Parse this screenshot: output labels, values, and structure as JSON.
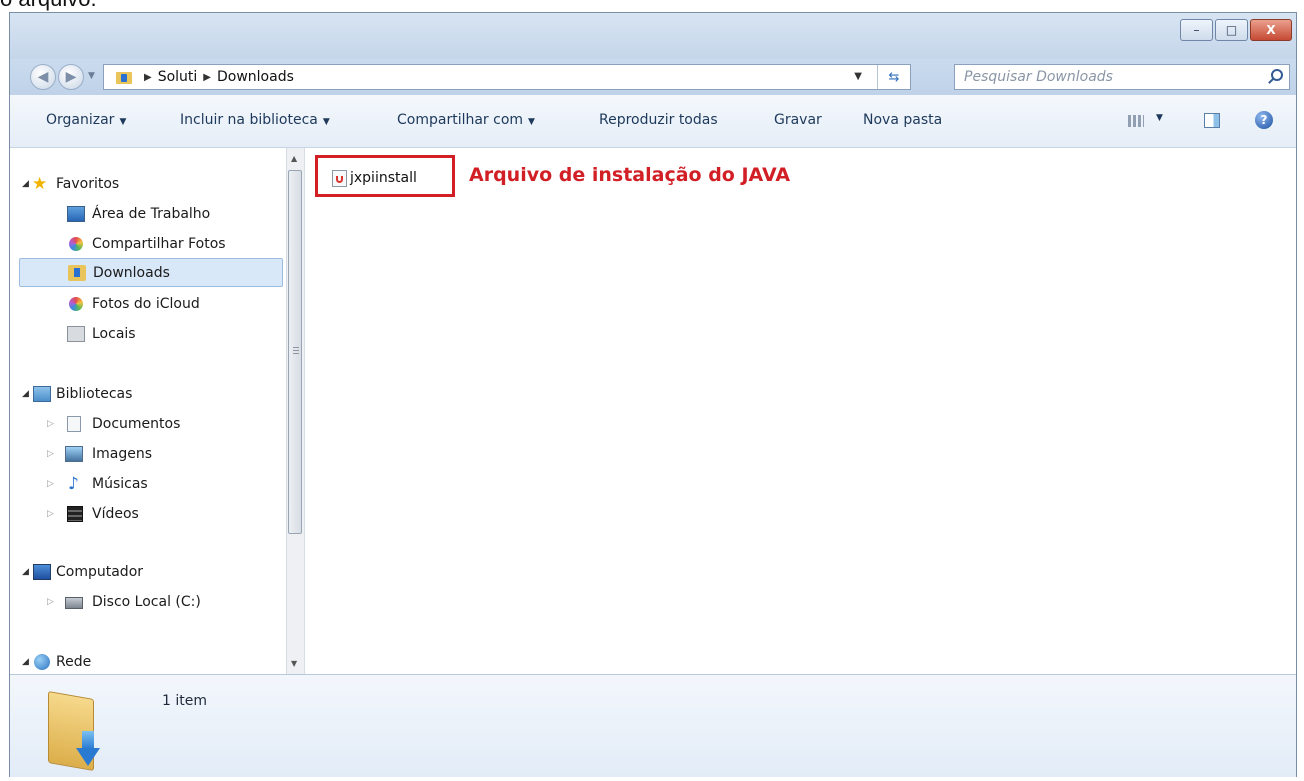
{
  "caption_above": "o arquivo.",
  "window": {
    "caption_buttons": {
      "minimize": "–",
      "maximize": "□",
      "close": "X"
    }
  },
  "address": {
    "crumbs": [
      "Soluti",
      "Downloads"
    ],
    "search_placeholder": "Pesquisar Downloads"
  },
  "toolbar": {
    "organize": "Organizar",
    "include_library": "Incluir na biblioteca",
    "share_with": "Compartilhar com",
    "play_all": "Reproduzir todas",
    "burn": "Gravar",
    "new_folder": "Nova pasta"
  },
  "nav": {
    "favorites": "Favoritos",
    "desktop": "Área de Trabalho",
    "shared_photos": "Compartilhar Fotos",
    "downloads": "Downloads",
    "icloud_photos": "Fotos do iCloud",
    "places": "Locais",
    "libraries": "Bibliotecas",
    "documents": "Documentos",
    "pictures": "Imagens",
    "music": "Músicas",
    "videos": "Vídeos",
    "computer": "Computador",
    "local_disk": "Disco Local (C:)",
    "network": "Rede"
  },
  "content": {
    "file_name": "jxpiinstall",
    "annotation": "Arquivo de instalação do JAVA"
  },
  "details": {
    "item_count": "1 item"
  },
  "colors": {
    "annotation_red": "#d11f25",
    "selection_blue": "#d9e8f8",
    "toolbar_text": "#1e395b"
  }
}
